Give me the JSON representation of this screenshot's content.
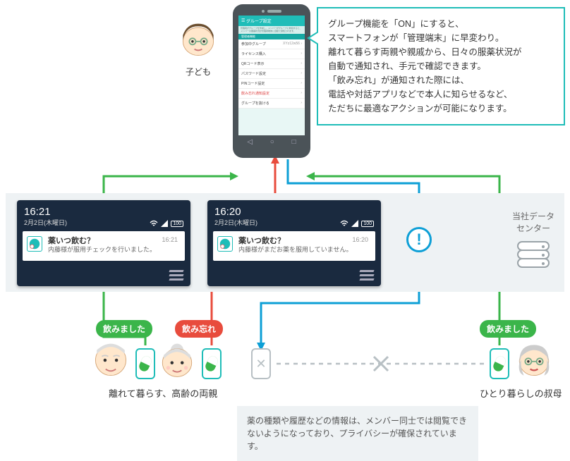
{
  "child": {
    "label": "子ども"
  },
  "phone": {
    "header": "グループ設定",
    "note": "管理者がグループを作成し、メンバーがグループに参加すると、メンバーの服薬状況が管理者端末に自動で通知されます。",
    "section": "管理者機能",
    "rows": [
      {
        "label": "参加中グループ",
        "right": "XYz12w56"
      },
      {
        "label": "ライセンス購入",
        "right": ""
      },
      {
        "label": "QRコード表示",
        "right": ""
      },
      {
        "label": "パスワード設定",
        "right": ""
      },
      {
        "label": "PINコード設定",
        "right": ""
      },
      {
        "label": "飲み忘れ通知設定",
        "right": "",
        "red": true
      },
      {
        "label": "グループを抜ける",
        "right": ""
      }
    ]
  },
  "callout": {
    "l1": "グループ機能を「ON」にすると、",
    "l2": "スマートフォンが「管理端末」に早変わり。",
    "l3": "離れて暮らす両親や親戚から、日々の服薬状況が",
    "l4": "自動で通知され、手元で確認できます。",
    "l5": "「飲み忘れ」が通知された際には、",
    "l6": "電話や対話アプリなどで本人に知らせるなど、",
    "l7": "ただちに最適なアクションが可能になります。"
  },
  "card1": {
    "time": "16:21",
    "date": "2月2日(木曜日)",
    "app": "薬いつ飲む？",
    "msg": "内藤様が服用チェックを行いました。",
    "t2": "16:21",
    "batt": "100"
  },
  "card2": {
    "time": "16:20",
    "date": "2月2日(木曜日)",
    "app": "薬いつ飲む？",
    "msg": "内藤様がまだお薬を服用していません。",
    "t2": "16:20",
    "batt": "100"
  },
  "dc": {
    "l1": "当社データ",
    "l2": "センター"
  },
  "pills": {
    "p1": "飲みました",
    "p2": "飲み忘れ",
    "p3": "飲みました"
  },
  "labels": {
    "parents": "離れて暮らす、高齢の両親",
    "aunt": "ひとり暮らしの叔母"
  },
  "priv": {
    "l1": "薬の種類や履歴などの情報は、メンバー同士では閲覧でき",
    "l2": "ないようになっており、プライバシーが確保されています。"
  }
}
